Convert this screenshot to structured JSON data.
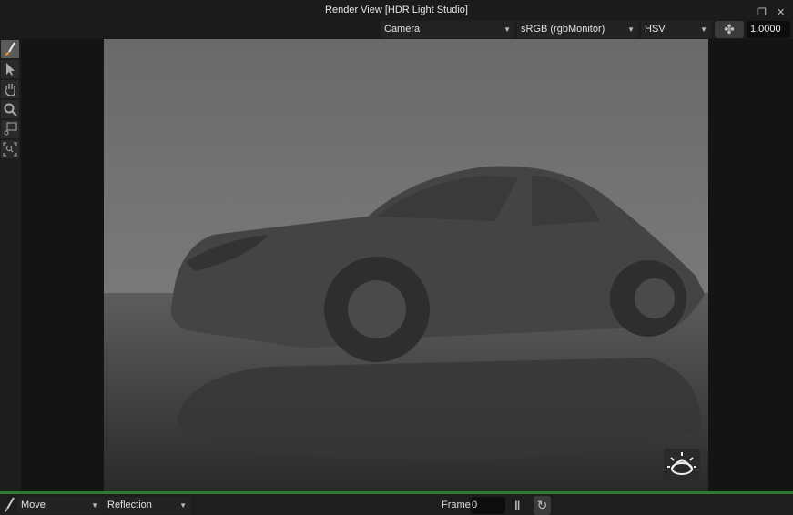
{
  "window": {
    "title": "Render View [HDR Light Studio]",
    "restore_icon": "restore-icon",
    "close_icon": "close-icon"
  },
  "toolbar": {
    "camera": "Camera",
    "colorspace": "sRGB (rgbMonitor)",
    "colormode": "HSV",
    "exposure": "1.0000"
  },
  "tools": [
    "paint-brush-icon",
    "pointer-icon",
    "hand-icon",
    "zoom-icon",
    "zoom-region-icon",
    "zoom-fit-icon"
  ],
  "bottom": {
    "mode": "Move",
    "target": "Reflection",
    "frame_label": "Frame",
    "frame_value": "0"
  },
  "colors": {
    "accent": "#2e7a2e",
    "brush": "#e8902a"
  }
}
